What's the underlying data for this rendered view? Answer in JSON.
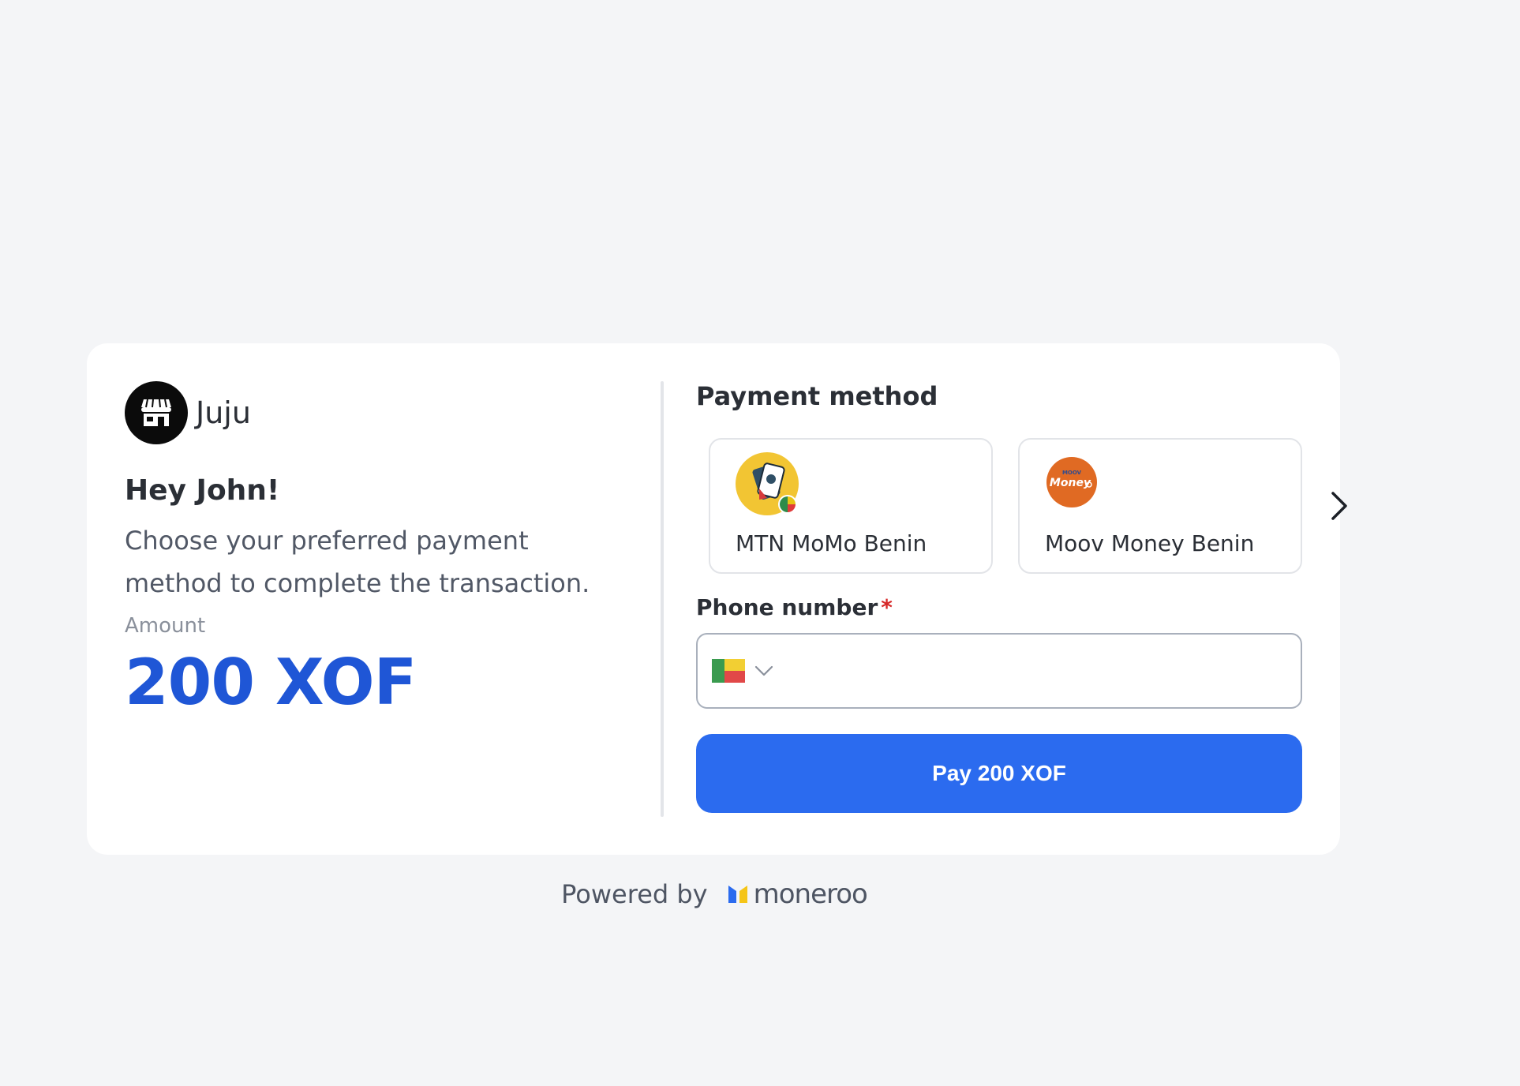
{
  "merchant": {
    "name": "Juju",
    "logo_icon": "storefront-icon"
  },
  "intro": {
    "greeting": "Hey John!",
    "description": "Choose your preferred payment method to complete the transaction."
  },
  "amount": {
    "label": "Amount",
    "value": "200 XOF"
  },
  "payment": {
    "title": "Payment method",
    "methods": [
      {
        "label": "MTN MoMo Benin",
        "icon": "mtn-momo-icon",
        "color": "#f2c533"
      },
      {
        "label": "Moov Money Benin",
        "icon": "moov-money-icon",
        "color": "#e06a23"
      }
    ],
    "next_icon": "chevron-right-icon"
  },
  "phone": {
    "label": "Phone number",
    "required_mark": "*",
    "value": "",
    "country_flag": "benin-flag-icon"
  },
  "pay_button": {
    "label": "Pay 200 XOF",
    "color": "#2b6bef"
  },
  "footer": {
    "powered_by": "Powered by",
    "brand": "moneroo"
  },
  "colors": {
    "accent": "#1f56d6",
    "background": "#f4f5f7"
  }
}
